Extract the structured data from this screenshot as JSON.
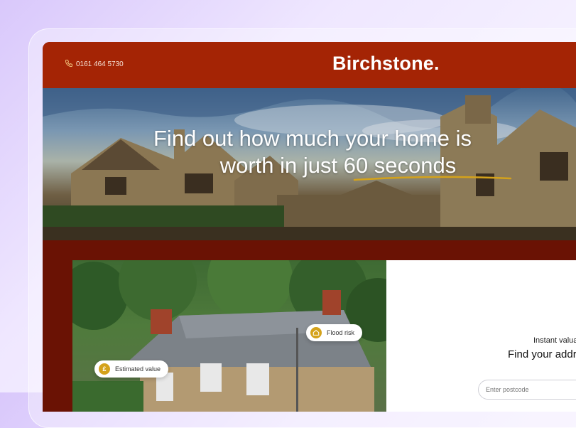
{
  "header": {
    "phone": "0161 464 5730",
    "logo": "Birchstone."
  },
  "hero": {
    "headline_line1": "Find out how much your home is",
    "headline_line2": "worth in just 60 seconds"
  },
  "photo_badges": {
    "flood_risk": "Flood risk",
    "estimated_value": "Estimated value",
    "estimated_value_symbol": "£"
  },
  "valuation_form": {
    "kicker": "Instant valuation r",
    "heading": "Find your address to",
    "postcode_placeholder": "Enter postcode"
  },
  "colors": {
    "header_bg": "#a42405",
    "site_bg": "#6a1204",
    "accent_yellow": "#d4a21b"
  }
}
